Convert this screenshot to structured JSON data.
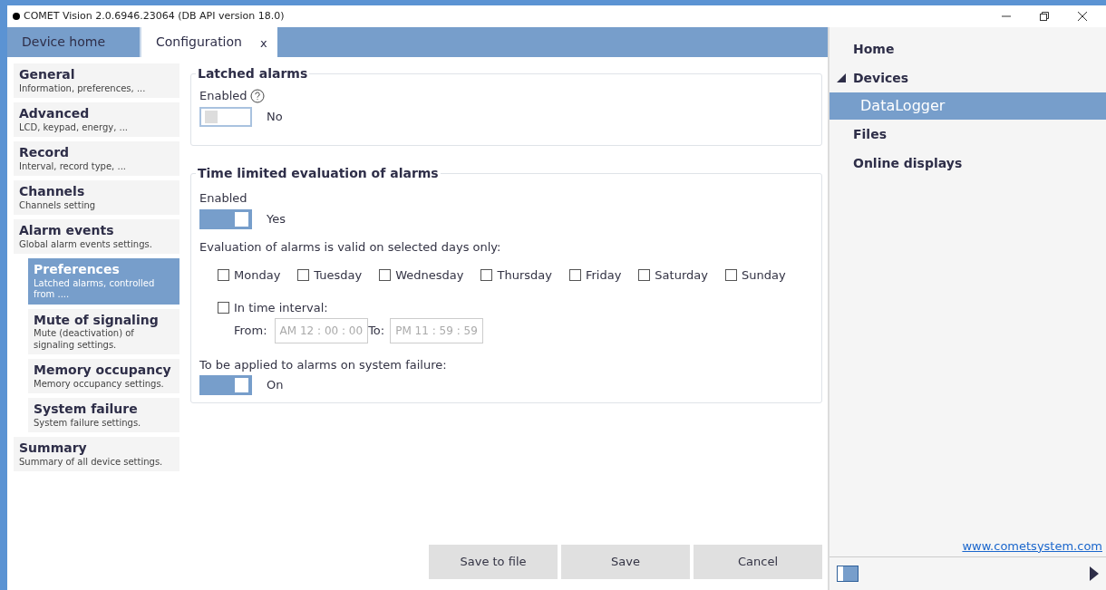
{
  "window": {
    "title": "COMET Vision 2.0.6946.23064 (DB API version 18.0)"
  },
  "tabs": [
    {
      "label": "Device home",
      "selected": false
    },
    {
      "label": "Configuration",
      "selected": true,
      "close_label": "x"
    }
  ],
  "sidebar": {
    "items": [
      {
        "title": "General",
        "subtitle": "Information, preferences, ...",
        "selected": false
      },
      {
        "title": "Advanced",
        "subtitle": "LCD, keypad, energy, ...",
        "selected": false
      },
      {
        "title": "Record",
        "subtitle": "Interval, record type, ...",
        "selected": false
      },
      {
        "title": "Channels",
        "subtitle": "Channels setting",
        "selected": false
      },
      {
        "title": "Alarm events",
        "subtitle": "Global alarm events settings.",
        "selected": false,
        "children": [
          {
            "title": "Preferences",
            "subtitle": "Latched alarms, controlled from ....",
            "selected": true
          },
          {
            "title": "Mute of signaling",
            "subtitle": "Mute (deactivation) of signaling settings.",
            "selected": false
          },
          {
            "title": "Memory occupancy",
            "subtitle": "Memory occupancy settings.",
            "selected": false
          },
          {
            "title": "System failure",
            "subtitle": "System failure settings.",
            "selected": false
          }
        ]
      },
      {
        "title": "Summary",
        "subtitle": "Summary of all device settings.",
        "selected": false
      }
    ]
  },
  "latched": {
    "title": "Latched alarms",
    "label": "Enabled",
    "toggle": {
      "on": false,
      "text": "No"
    }
  },
  "time_limited": {
    "title": "Time limited evaluation of alarms",
    "label": "Enabled",
    "toggle": {
      "on": true,
      "text": "Yes"
    },
    "days_label": "Evaluation of alarms is valid on selected days only:",
    "days": [
      {
        "label": "Monday",
        "checked": false
      },
      {
        "label": "Tuesday",
        "checked": false
      },
      {
        "label": "Wednesday",
        "checked": false
      },
      {
        "label": "Thursday",
        "checked": false
      },
      {
        "label": "Friday",
        "checked": false
      },
      {
        "label": "Saturday",
        "checked": false
      },
      {
        "label": "Sunday",
        "checked": false
      }
    ],
    "interval": {
      "label": "In time interval:",
      "checked": false,
      "from_label": "From:",
      "from": "AM 12 : 00 : 00",
      "to_label": "To:",
      "to": "PM 11 : 59 : 59"
    },
    "failure_label": "To be applied to alarms on system failure:",
    "failure_toggle": {
      "on": true,
      "text": "On"
    }
  },
  "buttons": [
    "Save to file",
    "Save",
    "Cancel"
  ],
  "nav": {
    "items": [
      {
        "label": "Home",
        "selected": false
      },
      {
        "label": "Devices",
        "selected": false,
        "expanded": true,
        "children": [
          {
            "label": "DataLogger",
            "selected": true
          }
        ]
      },
      {
        "label": "Files",
        "selected": false
      },
      {
        "label": "Online displays",
        "selected": false
      }
    ],
    "link": "www.cometsystem.com"
  }
}
